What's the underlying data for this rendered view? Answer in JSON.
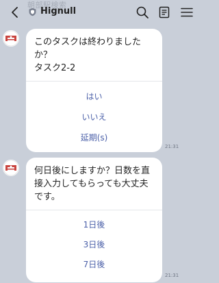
{
  "header": {
    "title": "Hignull",
    "under_text": "朝部駅検索"
  },
  "messages": [
    {
      "text": "このタスクは終わりました\nか？\nタスク2-2",
      "options": [
        "はい",
        "いいえ",
        "延期(s)"
      ],
      "time": "21:31"
    },
    {
      "text": "何日後にしますか？日数を直\n接入力してもらっても大丈夫\nです。",
      "options": [
        "1日後",
        "3日後",
        "7日後"
      ],
      "time": "21:31"
    }
  ],
  "colors": {
    "background": "#c9cfd9",
    "bubble": "#ffffff",
    "option_text": "#4a5fa8"
  }
}
